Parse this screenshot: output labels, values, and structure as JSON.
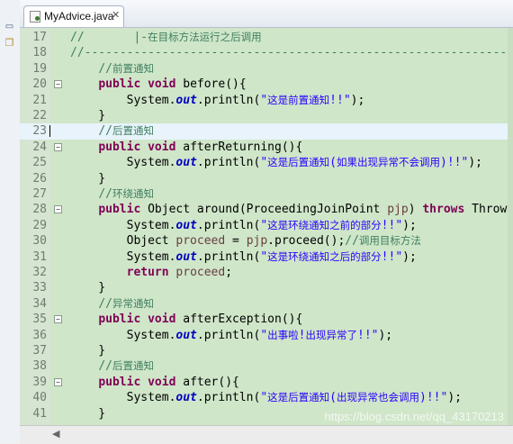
{
  "window": {
    "left_strip": {
      "minimize_icon": "minimize-icon",
      "restore_icon": "restore-icon"
    }
  },
  "tab": {
    "label": "MyAdvice.java",
    "close": "✕",
    "icon": "java-file-icon"
  },
  "editor": {
    "current_line": 23,
    "lines": [
      {
        "num": "17",
        "tokens": [
          {
            "t": "cm",
            "v": "//       |-在目标方法运行之后调用"
          }
        ]
      },
      {
        "num": "18",
        "tokens": [
          {
            "t": "cm",
            "v": "//---------------------------------------------------------------"
          }
        ]
      },
      {
        "num": "19",
        "tokens": [
          {
            "t": "",
            "v": "    "
          },
          {
            "t": "cm",
            "v": "//前置通知"
          }
        ]
      },
      {
        "num": "20",
        "tokens": [
          {
            "t": "",
            "v": "    "
          },
          {
            "t": "kw",
            "v": "public"
          },
          {
            "t": "",
            "v": " "
          },
          {
            "t": "kw",
            "v": "void"
          },
          {
            "t": "",
            "v": " before(){"
          }
        ]
      },
      {
        "num": "21",
        "tokens": [
          {
            "t": "",
            "v": "        System."
          },
          {
            "t": "fld",
            "v": "out"
          },
          {
            "t": "",
            "v": ".println("
          },
          {
            "t": "st",
            "v": "\"这是前置通知!!\""
          },
          {
            "t": "",
            "v": ");"
          }
        ]
      },
      {
        "num": "22",
        "tokens": [
          {
            "t": "",
            "v": "    }"
          }
        ]
      },
      {
        "num": "23",
        "tokens": [
          {
            "t": "",
            "v": "    "
          },
          {
            "t": "cm",
            "v": "//后置通知"
          }
        ]
      },
      {
        "num": "24",
        "tokens": [
          {
            "t": "",
            "v": "    "
          },
          {
            "t": "kw",
            "v": "public"
          },
          {
            "t": "",
            "v": " "
          },
          {
            "t": "kw",
            "v": "void"
          },
          {
            "t": "",
            "v": " afterReturning(){"
          }
        ]
      },
      {
        "num": "25",
        "tokens": [
          {
            "t": "",
            "v": "        System."
          },
          {
            "t": "fld",
            "v": "out"
          },
          {
            "t": "",
            "v": ".println("
          },
          {
            "t": "st",
            "v": "\"这是后置通知(如果出现异常不会调用)!!\""
          },
          {
            "t": "",
            "v": ");"
          }
        ]
      },
      {
        "num": "26",
        "tokens": [
          {
            "t": "",
            "v": "    }"
          }
        ]
      },
      {
        "num": "27",
        "tokens": [
          {
            "t": "",
            "v": "    "
          },
          {
            "t": "cm",
            "v": "//环绕通知"
          }
        ]
      },
      {
        "num": "28",
        "tokens": [
          {
            "t": "",
            "v": "    "
          },
          {
            "t": "kw",
            "v": "public"
          },
          {
            "t": "",
            "v": " Object around(ProceedingJoinPoint "
          },
          {
            "t": "var",
            "v": "pjp"
          },
          {
            "t": "",
            "v": ") "
          },
          {
            "t": "kw",
            "v": "throws"
          },
          {
            "t": "",
            "v": " Throwable {"
          }
        ]
      },
      {
        "num": "29",
        "tokens": [
          {
            "t": "",
            "v": "        System."
          },
          {
            "t": "fld",
            "v": "out"
          },
          {
            "t": "",
            "v": ".println("
          },
          {
            "t": "st",
            "v": "\"这是环绕通知之前的部分!!\""
          },
          {
            "t": "",
            "v": ");"
          }
        ]
      },
      {
        "num": "30",
        "tokens": [
          {
            "t": "",
            "v": "        Object "
          },
          {
            "t": "var",
            "v": "proceed"
          },
          {
            "t": "",
            "v": " = "
          },
          {
            "t": "var",
            "v": "pjp"
          },
          {
            "t": "",
            "v": ".proceed();"
          },
          {
            "t": "cm",
            "v": "//调用目标方法"
          }
        ]
      },
      {
        "num": "31",
        "tokens": [
          {
            "t": "",
            "v": "        System."
          },
          {
            "t": "fld",
            "v": "out"
          },
          {
            "t": "",
            "v": ".println("
          },
          {
            "t": "st",
            "v": "\"这是环绕通知之后的部分!!\""
          },
          {
            "t": "",
            "v": ");"
          }
        ]
      },
      {
        "num": "32",
        "tokens": [
          {
            "t": "",
            "v": "        "
          },
          {
            "t": "kw",
            "v": "return"
          },
          {
            "t": "",
            "v": " "
          },
          {
            "t": "var",
            "v": "proceed"
          },
          {
            "t": "",
            "v": ";"
          }
        ]
      },
      {
        "num": "33",
        "tokens": [
          {
            "t": "",
            "v": "    }"
          }
        ]
      },
      {
        "num": "34",
        "tokens": [
          {
            "t": "",
            "v": "    "
          },
          {
            "t": "cm",
            "v": "//异常通知"
          }
        ]
      },
      {
        "num": "35",
        "tokens": [
          {
            "t": "",
            "v": "    "
          },
          {
            "t": "kw",
            "v": "public"
          },
          {
            "t": "",
            "v": " "
          },
          {
            "t": "kw",
            "v": "void"
          },
          {
            "t": "",
            "v": " afterException(){"
          }
        ]
      },
      {
        "num": "36",
        "tokens": [
          {
            "t": "",
            "v": "        System."
          },
          {
            "t": "fld",
            "v": "out"
          },
          {
            "t": "",
            "v": ".println("
          },
          {
            "t": "st",
            "v": "\"出事啦!出现异常了!!\""
          },
          {
            "t": "",
            "v": ");"
          }
        ]
      },
      {
        "num": "37",
        "tokens": [
          {
            "t": "",
            "v": "    }"
          }
        ]
      },
      {
        "num": "38",
        "tokens": [
          {
            "t": "",
            "v": "    "
          },
          {
            "t": "cm",
            "v": "//后置通知"
          }
        ]
      },
      {
        "num": "39",
        "tokens": [
          {
            "t": "",
            "v": "    "
          },
          {
            "t": "kw",
            "v": "public"
          },
          {
            "t": "",
            "v": " "
          },
          {
            "t": "kw",
            "v": "void"
          },
          {
            "t": "",
            "v": " after(){"
          }
        ]
      },
      {
        "num": "40",
        "tokens": [
          {
            "t": "",
            "v": "        System."
          },
          {
            "t": "fld",
            "v": "out"
          },
          {
            "t": "",
            "v": ".println("
          },
          {
            "t": "st",
            "v": "\"这是后置通知(出现异常也会调用)!!\""
          },
          {
            "t": "",
            "v": ");"
          }
        ]
      },
      {
        "num": "41",
        "tokens": [
          {
            "t": "",
            "v": "    }"
          }
        ]
      }
    ],
    "fold_lines": [
      "20",
      "24",
      "28",
      "35",
      "39"
    ]
  },
  "watermark": "https://blog.csdn.net/qq_43170213",
  "colors": {
    "keyword": "#7f0055",
    "comment": "#3f7f5f",
    "string": "#2a00ff",
    "field": "#0000c0",
    "variable": "#6a3e3e",
    "editor_bg": "#cfe6c9"
  }
}
